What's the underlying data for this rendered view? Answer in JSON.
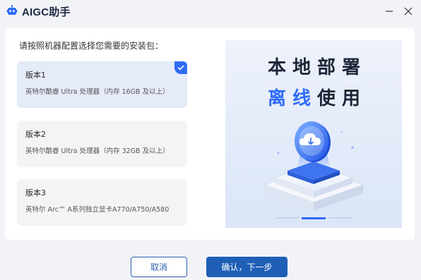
{
  "window": {
    "title": "AIGC助手",
    "controls": {
      "minimize_icon": "minimize-icon",
      "close_icon": "close-icon"
    }
  },
  "main": {
    "prompt": "请按照机器配置选择您需要的安装包：",
    "options": [
      {
        "name": "版本1",
        "desc": "英特尔酷睿 Ultra 处理器（内存 16GB 及以上）",
        "selected": true
      },
      {
        "name": "版本2",
        "desc": "英特尔酷睿 Ultra 处理器（内存 32GB 及以上）",
        "selected": false
      },
      {
        "name": "版本3",
        "desc": "英特尔 Arc™ A系列独立显卡A770/A750/A580",
        "selected": false
      }
    ],
    "banner": {
      "line1": "本地部署",
      "line2_highlight": "离线",
      "line2_rest": "使用",
      "slides": 3,
      "active_slide": 2
    }
  },
  "footer": {
    "cancel_label": "取消",
    "confirm_label": "确认，下一步"
  },
  "colors": {
    "accent": "#2f6cf6",
    "confirm_button": "#1f5fb6",
    "selected_option_bg": "#e6ebfa",
    "option_bg": "#f3f4f6"
  }
}
